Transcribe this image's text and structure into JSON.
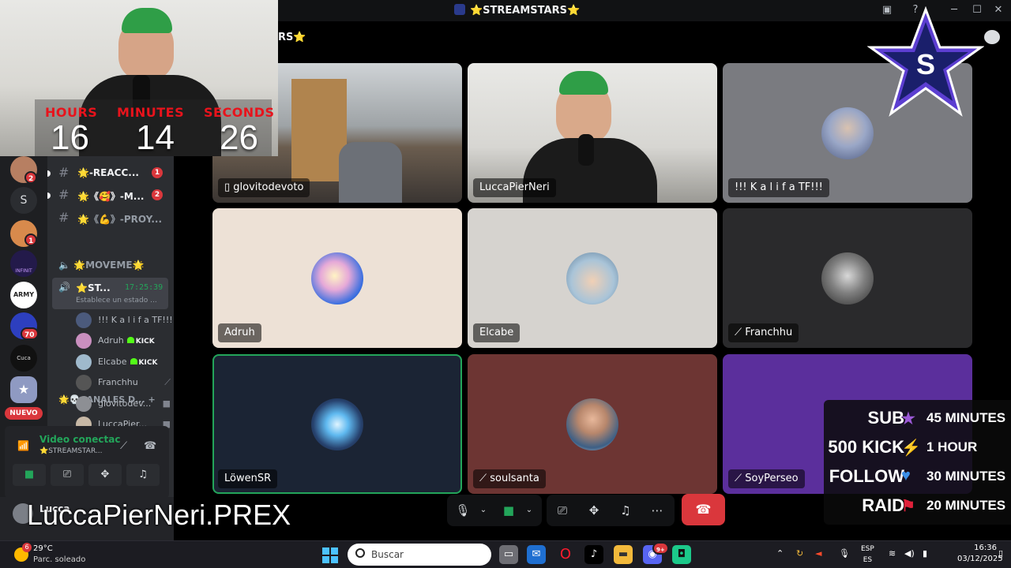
{
  "window": {
    "title": "⭐STREAMSTARS⭐",
    "help": "?",
    "minimize": "─",
    "maximize": "☐",
    "close": "✕"
  },
  "stage": {
    "title_partial": "RS⭐"
  },
  "timer": {
    "hours_label": "HOURS",
    "minutes_label": "MINUTES",
    "seconds_label": "SECONDS",
    "hours": "16",
    "minutes": "14",
    "seconds": "26"
  },
  "servers": [
    {
      "badge": "2"
    },
    {
      "letter": "S"
    },
    {
      "badge": "1"
    },
    {
      "name": "INFINIT"
    },
    {
      "name": "ARMY"
    },
    {
      "badge": "70"
    },
    {
      "name": "Cuca"
    },
    {
      "name": "star"
    }
  ],
  "nuevo_label": "NUEVO",
  "channels": [
    {
      "name": "🌟-REACC...",
      "mentions": "1"
    },
    {
      "name": "🌟《🥰》-M...",
      "mentions": "2"
    },
    {
      "name": "🌟《💪》-PROY...",
      "mentions": ""
    }
  ],
  "category": {
    "name": "🌟💀CANALES D...",
    "add": "+"
  },
  "voice_channels": {
    "moveme": "🌟MOVEME🌟"
  },
  "active_voice": {
    "name": "⭐ST...",
    "time": "17:25:39",
    "status": "Establece un estado ..."
  },
  "voice_users": [
    {
      "name": "!!! K a l i f a TF!!!",
      "kick": false,
      "right": ""
    },
    {
      "name": "Adruh",
      "kick": true,
      "right": ""
    },
    {
      "name": "Elcabe",
      "kick": true,
      "right": ""
    },
    {
      "name": "Franchhu",
      "kick": false,
      "right": "🎙"
    },
    {
      "name": "glovitodev...",
      "kick": false,
      "right": "▶"
    },
    {
      "name": "LuccaPier...",
      "kick": false,
      "right": "▶"
    }
  ],
  "kick_label": "KICK",
  "voice_connection": {
    "status": "Video conectac",
    "channel": "⭐STREAMSTAR..."
  },
  "user": {
    "name": "Lucca"
  },
  "tiles": [
    {
      "label": "glovitodevoto"
    },
    {
      "label": "LuccaPierNeri"
    },
    {
      "label": "!!! K a l i f a TF!!!"
    },
    {
      "label": "Adruh"
    },
    {
      "label": "Elcabe"
    },
    {
      "label": "Franchhu"
    },
    {
      "label": "LöwenSR"
    },
    {
      "label": "soulsanta"
    },
    {
      "label": "SoyPerseo"
    }
  ],
  "overlay_name": "LuccaPierNeri.PREX",
  "rewards": [
    {
      "left": "SUB",
      "icon": "★",
      "right": "45 MINUTES",
      "color": "#9b59d6"
    },
    {
      "left": "500 KICK",
      "icon": "⚡",
      "right": "1 HOUR",
      "color": "#f5b819"
    },
    {
      "left": "FOLLOW",
      "icon": "♥",
      "right": "30 MINUTES",
      "color": "#3b8fe8"
    },
    {
      "left": "RAID",
      "icon": "⚑",
      "right": "20 MINUTES",
      "color": "#e0213a"
    }
  ],
  "taskbar": {
    "weather_temp": "29°C",
    "weather_desc": "Parc. soleado",
    "weather_badge": "6",
    "search_placeholder": "Buscar",
    "lang1": "ESP",
    "lang2": "ES",
    "time": "16:36",
    "date": "03/12/2025",
    "discord_badge": "9+"
  },
  "colors": {
    "accent_green": "#23a55a",
    "danger": "#da373c",
    "timer_red": "#e8131c"
  }
}
